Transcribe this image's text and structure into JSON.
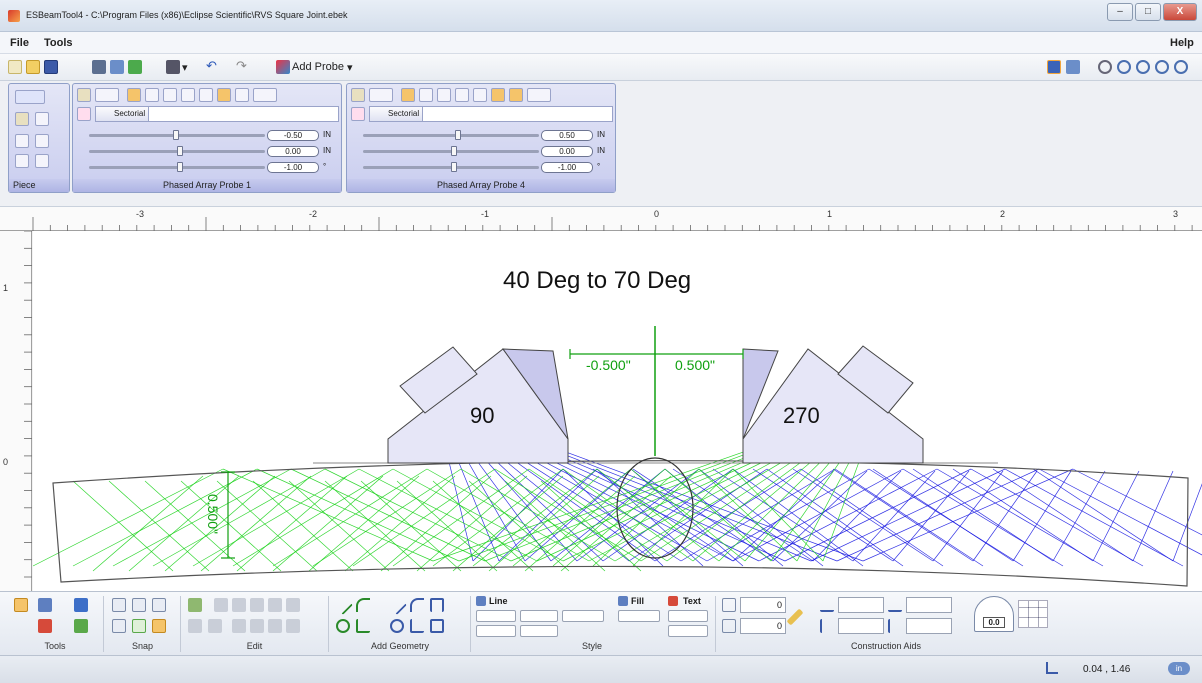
{
  "window": {
    "title": "ESBeamTool4 - C:\\Program Files (x86)\\Eclipse Scientific\\RVS Square Joint.ebek",
    "controls": {
      "minimize": "–",
      "maximize": "□",
      "close": "X"
    }
  },
  "menu": {
    "file": "File",
    "tools": "Tools",
    "help": "Help"
  },
  "toolbar": {
    "add_probe": "Add Probe",
    "dropdown": "▾",
    "undo": "↶",
    "redo": "↷"
  },
  "piece_panel": {
    "label": "Piece"
  },
  "probes": [
    {
      "title": "Phased Array Probe 1",
      "tab": "Sectorial",
      "sliders": [
        {
          "value": "-0.50",
          "unit": "IN"
        },
        {
          "value": "0.00",
          "unit": "IN"
        },
        {
          "value": "-1.00",
          "unit": "°"
        }
      ]
    },
    {
      "title": "Phased Array Probe 4",
      "tab": "Sectorial",
      "sliders": [
        {
          "value": "0.50",
          "unit": "IN"
        },
        {
          "value": "0.00",
          "unit": "IN"
        },
        {
          "value": "-1.00",
          "unit": "°"
        }
      ]
    }
  ],
  "ruler": {
    "h": [
      "-3",
      "-2",
      "-1",
      "0",
      "1",
      "2",
      "3"
    ],
    "v": [
      "1",
      "0"
    ]
  },
  "canvas": {
    "heading": "40 Deg to 70 Deg",
    "probe_left_label": "90",
    "probe_right_label": "270",
    "offset_left": "-0.500\"",
    "offset_right": "0.500\"",
    "thickness": "0.500\"",
    "colors": {
      "left_beam": "#1010e0",
      "right_beam": "#10d010",
      "offset_lines": "#10a010"
    }
  },
  "bottom_groups": {
    "tools": "Tools",
    "snap": "Snap",
    "edit": "Edit",
    "add_geometry": "Add Geometry",
    "style": "Style",
    "construction": "Construction Aids"
  },
  "style": {
    "line": "Line",
    "fill": "Fill",
    "text": "Text"
  },
  "construction": {
    "field1": "0",
    "field2": "0",
    "dial": "0.0"
  },
  "status": {
    "coords": "0.04 , 1.46",
    "units": "in"
  }
}
